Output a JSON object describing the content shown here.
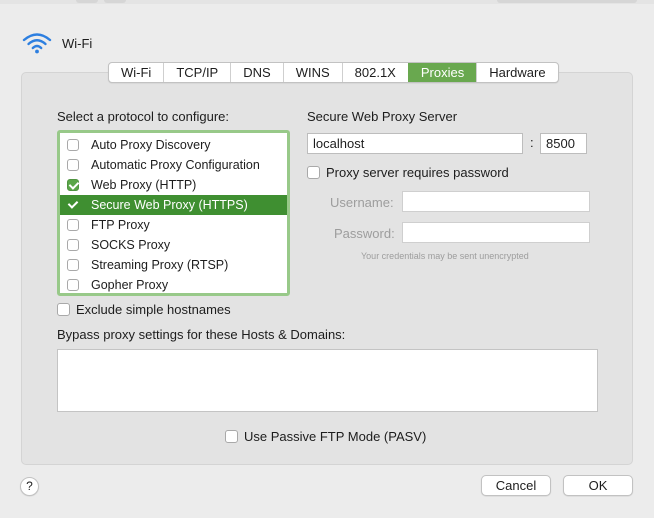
{
  "header": {
    "title": "Wi-Fi",
    "icon": "wifi-icon"
  },
  "tabs": [
    {
      "label": "Wi-Fi",
      "active": false
    },
    {
      "label": "TCP/IP",
      "active": false
    },
    {
      "label": "DNS",
      "active": false
    },
    {
      "label": "WINS",
      "active": false
    },
    {
      "label": "802.1X",
      "active": false
    },
    {
      "label": "Proxies",
      "active": true
    },
    {
      "label": "Hardware",
      "active": false
    }
  ],
  "protocols": {
    "heading": "Select a protocol to configure:",
    "items": [
      {
        "label": "Auto Proxy Discovery",
        "checked": false,
        "selected": false
      },
      {
        "label": "Automatic Proxy Configuration",
        "checked": false,
        "selected": false
      },
      {
        "label": "Web Proxy (HTTP)",
        "checked": true,
        "selected": false
      },
      {
        "label": "Secure Web Proxy (HTTPS)",
        "checked": true,
        "selected": true
      },
      {
        "label": "FTP Proxy",
        "checked": false,
        "selected": false
      },
      {
        "label": "SOCKS Proxy",
        "checked": false,
        "selected": false
      },
      {
        "label": "Streaming Proxy (RTSP)",
        "checked": false,
        "selected": false
      },
      {
        "label": "Gopher Proxy",
        "checked": false,
        "selected": false
      }
    ]
  },
  "server": {
    "heading": "Secure Web Proxy Server",
    "host": "localhost",
    "separator": ":",
    "port": "8500",
    "requires_password_label": "Proxy server requires password",
    "requires_password": false,
    "username_label": "Username:",
    "username": "",
    "password_label": "Password:",
    "password": "",
    "note": "Your credentials may be sent unencrypted"
  },
  "exclude_simple": {
    "label": "Exclude simple hostnames",
    "checked": false
  },
  "bypass": {
    "label": "Bypass proxy settings for these Hosts & Domains:",
    "value": ""
  },
  "passive_ftp": {
    "label": "Use Passive FTP Mode (PASV)",
    "checked": false
  },
  "buttons": {
    "help": "?",
    "cancel": "Cancel",
    "ok": "OK"
  },
  "colors": {
    "accent": "#69a84f",
    "selection": "#3f8f31",
    "focus_ring": "#98c989",
    "wifi_blue": "#2d7fe0"
  }
}
